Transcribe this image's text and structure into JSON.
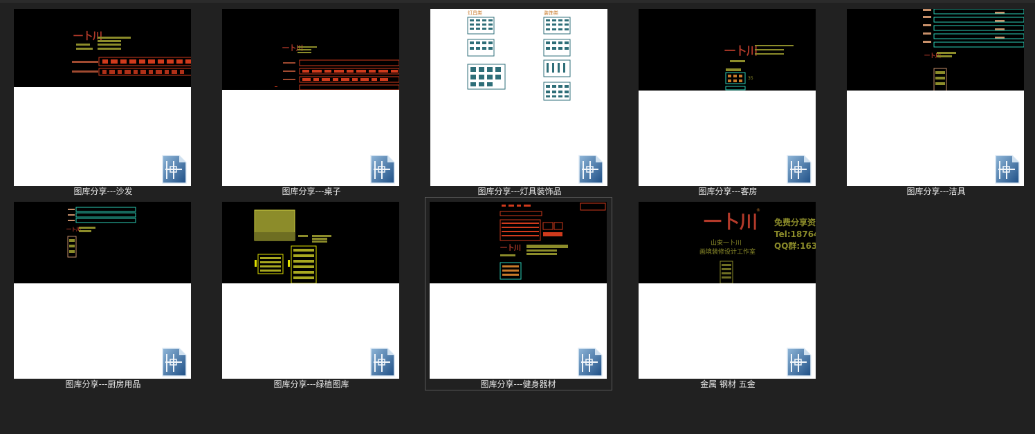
{
  "files": [
    {
      "id": "sofa",
      "name": "图库分享---沙发",
      "file_type_icon": "dwg-file-icon"
    },
    {
      "id": "table",
      "name": "图库分享---桌子",
      "file_type_icon": "dwg-file-icon"
    },
    {
      "id": "lamps",
      "name": "图库分享---灯具装饰品",
      "file_type_icon": "dwg-file-icon",
      "preview_text": {
        "left_heading": "灯具类",
        "right_heading": "装饰类"
      }
    },
    {
      "id": "guestroom",
      "name": "图库分享---客房",
      "file_type_icon": "dwg-file-icon"
    },
    {
      "id": "sanitary",
      "name": "图库分享---洁具",
      "file_type_icon": "dwg-file-icon"
    },
    {
      "id": "kitchen",
      "name": "图库分享---厨房用品",
      "file_type_icon": "dwg-file-icon"
    },
    {
      "id": "plants",
      "name": "图库分享---绿植图库",
      "file_type_icon": "dwg-file-icon"
    },
    {
      "id": "fitness",
      "name": "图库分享---健身器材",
      "file_type_icon": "dwg-file-icon",
      "selected": true
    },
    {
      "id": "metal",
      "name": "金属 钢材 五金",
      "file_type_icon": "dwg-file-icon",
      "preview_text": {
        "line1": "免费分享资",
        "line2": "Tel:18764",
        "line3": "QQ群:163",
        "sub1": "山東一卜川",
        "sub2": "画境装修设计工作室"
      }
    }
  ],
  "colors": {
    "background": "#212121",
    "label_text": "#e8e8e8",
    "cad_red": "#d03a1c",
    "cad_olive": "#8c8c2a",
    "cad_cyan": "#2bd1b8",
    "cad_yellow": "#e0e000"
  }
}
